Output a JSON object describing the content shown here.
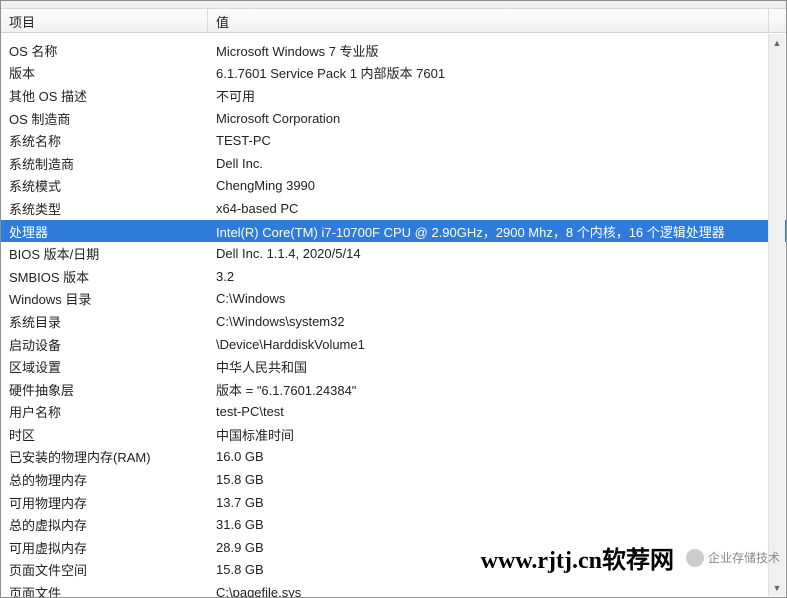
{
  "columns": {
    "item": "项目",
    "value": "值"
  },
  "rows": [
    {
      "item": "OS 名称",
      "value": "Microsoft Windows 7 专业版",
      "selected": false
    },
    {
      "item": "版本",
      "value": "6.1.7601 Service Pack 1 内部版本 7601",
      "selected": false
    },
    {
      "item": "其他 OS 描述",
      "value": "不可用",
      "selected": false
    },
    {
      "item": "OS 制造商",
      "value": "Microsoft Corporation",
      "selected": false
    },
    {
      "item": "系统名称",
      "value": "TEST-PC",
      "selected": false
    },
    {
      "item": "系统制造商",
      "value": "Dell Inc.",
      "selected": false
    },
    {
      "item": "系统模式",
      "value": "ChengMing 3990",
      "selected": false
    },
    {
      "item": "系统类型",
      "value": "x64-based PC",
      "selected": false
    },
    {
      "item": "处理器",
      "value": "Intel(R) Core(TM) i7-10700F CPU @ 2.90GHz，2900 Mhz，8 个内核，16 个逻辑处理器",
      "selected": true
    },
    {
      "item": "BIOS 版本/日期",
      "value": "Dell Inc. 1.1.4, 2020/5/14",
      "selected": false
    },
    {
      "item": "SMBIOS 版本",
      "value": "3.2",
      "selected": false
    },
    {
      "item": "Windows 目录",
      "value": "C:\\Windows",
      "selected": false
    },
    {
      "item": "系统目录",
      "value": "C:\\Windows\\system32",
      "selected": false
    },
    {
      "item": "启动设备",
      "value": "\\Device\\HarddiskVolume1",
      "selected": false
    },
    {
      "item": "区域设置",
      "value": "中华人民共和国",
      "selected": false
    },
    {
      "item": "硬件抽象层",
      "value": "版本 = \"6.1.7601.24384\"",
      "selected": false
    },
    {
      "item": "用户名称",
      "value": "test-PC\\test",
      "selected": false
    },
    {
      "item": "时区",
      "value": "中国标准时间",
      "selected": false
    },
    {
      "item": "已安装的物理内存(RAM)",
      "value": "16.0 GB",
      "selected": false
    },
    {
      "item": "总的物理内存",
      "value": "15.8 GB",
      "selected": false
    },
    {
      "item": "可用物理内存",
      "value": "13.7 GB",
      "selected": false
    },
    {
      "item": "总的虚拟内存",
      "value": "31.6 GB",
      "selected": false
    },
    {
      "item": "可用虚拟内存",
      "value": "28.9 GB",
      "selected": false
    },
    {
      "item": "页面文件空间",
      "value": "15.8 GB",
      "selected": false
    },
    {
      "item": "页面文件",
      "value": "C:\\pagefile.sys",
      "selected": false
    }
  ],
  "watermark": {
    "url_text": "www.rjtj.cn软荐网",
    "badge_text": "企业存储技术"
  }
}
